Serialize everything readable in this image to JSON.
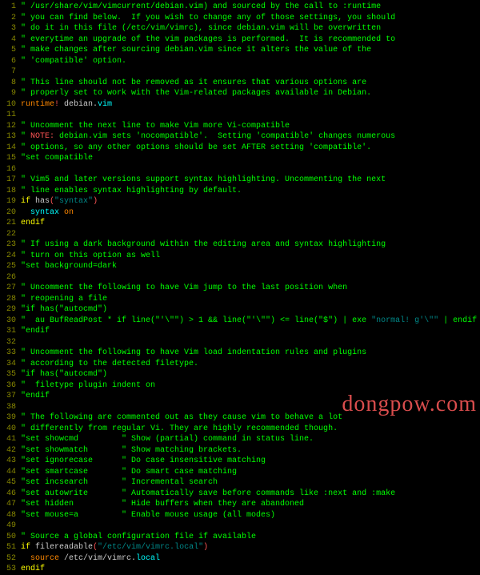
{
  "watermark": "dongpow.com",
  "lines": [
    {
      "n": 1,
      "seg": [
        [
          "q",
          "\" /usr/share/vim/vimcurrent/debian.vim) and sourced by the call to :runtime"
        ]
      ]
    },
    {
      "n": 2,
      "seg": [
        [
          "q",
          "\" you can find below.  If you wish to change any of those settings, you should"
        ]
      ]
    },
    {
      "n": 3,
      "seg": [
        [
          "q",
          "\" do it in this file (/etc/vim/vimrc), since debian.vim will be overwritten"
        ]
      ]
    },
    {
      "n": 4,
      "seg": [
        [
          "q",
          "\" everytime an upgrade of the vim packages is performed.  It is recommended to"
        ]
      ]
    },
    {
      "n": 5,
      "seg": [
        [
          "q",
          "\" make changes after sourcing debian.vim since it alters the value of the"
        ]
      ]
    },
    {
      "n": 6,
      "seg": [
        [
          "q",
          "\" 'compatible' option."
        ]
      ]
    },
    {
      "n": 7,
      "seg": [
        [
          "q",
          ""
        ]
      ]
    },
    {
      "n": 8,
      "seg": [
        [
          "q",
          "\" This line should not be removed as it ensures that various options are"
        ]
      ]
    },
    {
      "n": 9,
      "seg": [
        [
          "q",
          "\" properly set to work with the Vim-related packages available in Debian."
        ]
      ]
    },
    {
      "n": 10,
      "seg": [
        [
          "oran",
          "runtime"
        ],
        [
          "red",
          "!"
        ],
        [
          "wht",
          " debian."
        ],
        [
          "cyan",
          "vim"
        ]
      ]
    },
    {
      "n": 11,
      "seg": [
        [
          "q",
          ""
        ]
      ]
    },
    {
      "n": 12,
      "seg": [
        [
          "q",
          "\" Uncomment the next line to make Vim more Vi-compatible"
        ]
      ]
    },
    {
      "n": 13,
      "seg": [
        [
          "q",
          "\" "
        ],
        [
          "red",
          "NOTE:"
        ],
        [
          "q",
          " debian.vim sets 'nocompatible'.  Setting 'compatible' changes numerous"
        ]
      ]
    },
    {
      "n": 14,
      "seg": [
        [
          "q",
          "\" options, so any other options should be set AFTER setting 'compatible'."
        ]
      ]
    },
    {
      "n": 15,
      "seg": [
        [
          "q",
          "\"set compatible"
        ]
      ]
    },
    {
      "n": 16,
      "seg": [
        [
          "q",
          ""
        ]
      ]
    },
    {
      "n": 17,
      "seg": [
        [
          "q",
          "\" Vim5 and later versions support syntax highlighting. Uncommenting the next"
        ]
      ]
    },
    {
      "n": 18,
      "seg": [
        [
          "q",
          "\" line enables syntax highlighting by default."
        ]
      ]
    },
    {
      "n": 19,
      "seg": [
        [
          "yel",
          "if"
        ],
        [
          "wht",
          " has"
        ],
        [
          "red",
          "("
        ],
        [
          "dcyan",
          "\"syntax\""
        ],
        [
          "red",
          ")"
        ]
      ]
    },
    {
      "n": 20,
      "seg": [
        [
          "cyan",
          "  syntax"
        ],
        [
          "oran",
          " on"
        ]
      ]
    },
    {
      "n": 21,
      "seg": [
        [
          "yel",
          "endif"
        ]
      ]
    },
    {
      "n": 22,
      "seg": [
        [
          "q",
          ""
        ]
      ]
    },
    {
      "n": 23,
      "seg": [
        [
          "q",
          "\" If using a dark background within the editing area and syntax highlighting"
        ]
      ]
    },
    {
      "n": 24,
      "seg": [
        [
          "q",
          "\" turn on this option as well"
        ]
      ]
    },
    {
      "n": 25,
      "seg": [
        [
          "q",
          "\"set background=dark"
        ]
      ]
    },
    {
      "n": 26,
      "seg": [
        [
          "q",
          ""
        ]
      ]
    },
    {
      "n": 27,
      "seg": [
        [
          "q",
          "\" Uncomment the following to have Vim jump to the last position when"
        ]
      ]
    },
    {
      "n": 28,
      "seg": [
        [
          "q",
          "\" reopening a file"
        ]
      ]
    },
    {
      "n": 29,
      "seg": [
        [
          "q",
          "\"if has(\"autocmd\")"
        ]
      ]
    },
    {
      "n": 30,
      "seg": [
        [
          "q",
          "\"  au BufReadPost * if line(\"'\\\"\") > 1 && line(\"'\\\"\") <= line(\"$\") | exe "
        ],
        [
          "dcyan",
          "\"normal! g'\\\"\""
        ],
        [
          "q",
          " | endif"
        ]
      ]
    },
    {
      "n": 31,
      "seg": [
        [
          "q",
          "\"endif"
        ]
      ]
    },
    {
      "n": 32,
      "seg": [
        [
          "q",
          ""
        ]
      ]
    },
    {
      "n": 33,
      "seg": [
        [
          "q",
          "\" Uncomment the following to have Vim load indentation rules and plugins"
        ]
      ]
    },
    {
      "n": 34,
      "seg": [
        [
          "q",
          "\" according to the detected filetype."
        ]
      ]
    },
    {
      "n": 35,
      "seg": [
        [
          "q",
          "\"if has(\"autocmd\")"
        ]
      ]
    },
    {
      "n": 36,
      "seg": [
        [
          "q",
          "\"  filetype plugin indent on"
        ]
      ]
    },
    {
      "n": 37,
      "seg": [
        [
          "q",
          "\"endif"
        ]
      ]
    },
    {
      "n": 38,
      "seg": [
        [
          "q",
          ""
        ]
      ]
    },
    {
      "n": 39,
      "seg": [
        [
          "q",
          "\" The following are commented out as they cause vim to behave a lot"
        ]
      ]
    },
    {
      "n": 40,
      "seg": [
        [
          "q",
          "\" differently from regular Vi. They are highly recommended though."
        ]
      ]
    },
    {
      "n": 41,
      "seg": [
        [
          "q",
          "\"set showcmd         \" Show (partial) command in status line."
        ]
      ]
    },
    {
      "n": 42,
      "seg": [
        [
          "q",
          "\"set showmatch       \" Show matching brackets."
        ]
      ]
    },
    {
      "n": 43,
      "seg": [
        [
          "q",
          "\"set ignorecase      \" Do case insensitive matching"
        ]
      ]
    },
    {
      "n": 44,
      "seg": [
        [
          "q",
          "\"set smartcase       \" Do smart case matching"
        ]
      ]
    },
    {
      "n": 45,
      "seg": [
        [
          "q",
          "\"set incsearch       \" Incremental search"
        ]
      ]
    },
    {
      "n": 46,
      "seg": [
        [
          "q",
          "\"set autowrite       \" Automatically save before commands like :next and :make"
        ]
      ]
    },
    {
      "n": 47,
      "seg": [
        [
          "q",
          "\"set hidden          \" Hide buffers when they are abandoned"
        ]
      ]
    },
    {
      "n": 48,
      "seg": [
        [
          "q",
          "\"set mouse=a         \" Enable mouse usage (all modes)"
        ]
      ]
    },
    {
      "n": 49,
      "seg": [
        [
          "q",
          ""
        ]
      ]
    },
    {
      "n": 50,
      "seg": [
        [
          "q",
          "\" Source a global configuration file if available"
        ]
      ]
    },
    {
      "n": 51,
      "seg": [
        [
          "yel",
          "if"
        ],
        [
          "wht",
          " filereadable"
        ],
        [
          "red",
          "("
        ],
        [
          "dcyan",
          "\"/etc/vim/vimrc.local\""
        ],
        [
          "red",
          ")"
        ]
      ]
    },
    {
      "n": 52,
      "seg": [
        [
          "oran",
          "  source"
        ],
        [
          "wht",
          " /etc/vim/vimrc."
        ],
        [
          "cyan",
          "local"
        ]
      ]
    },
    {
      "n": 53,
      "seg": [
        [
          "yel",
          "endif"
        ]
      ]
    }
  ]
}
